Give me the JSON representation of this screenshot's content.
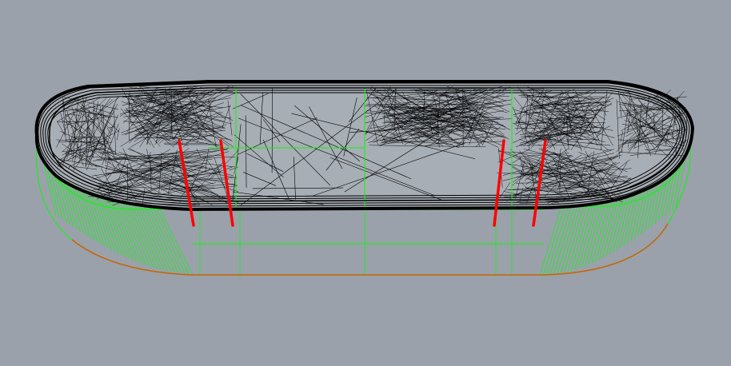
{
  "viewport": {
    "background_color": "#9aa1aa",
    "display_mode": "wireframe",
    "colors": {
      "side_wall": "#00ff00",
      "top_mesh": "#000000",
      "deck_fill": "#a8aeb5",
      "truck_axles": "#ff0000",
      "bottom_edge": "#c86400"
    }
  }
}
